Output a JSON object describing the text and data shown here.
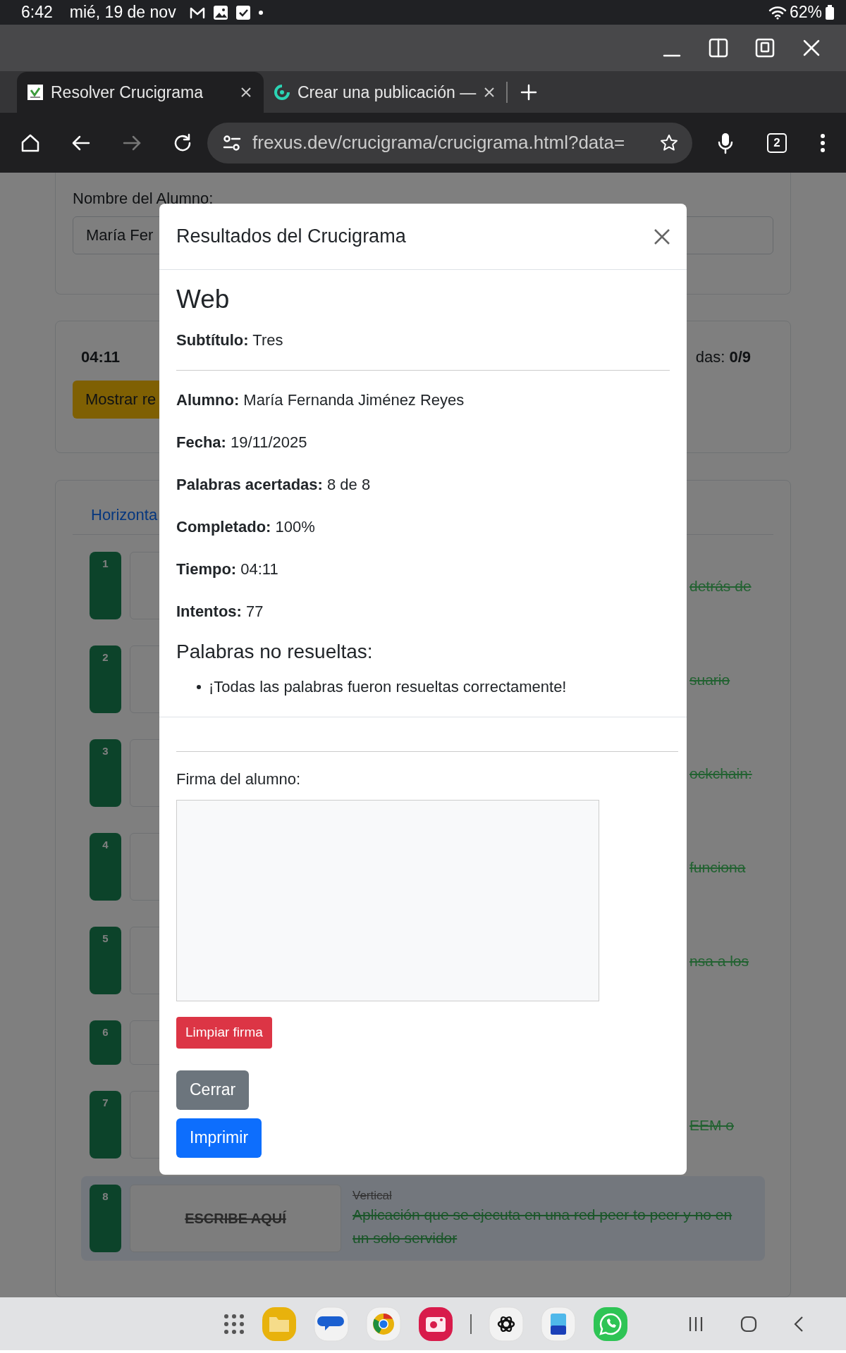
{
  "status_bar": {
    "time": "6:42",
    "date": "mié, 19 de nov",
    "battery": "62%"
  },
  "browser": {
    "tabs": [
      {
        "title": "Resolver Crucigrama",
        "selected": true
      },
      {
        "title": "Crear una publicación —",
        "selected": false
      }
    ],
    "url": "frexus.dev/crucigrama/crucigrama.html?data=",
    "tab_count": "2"
  },
  "page": {
    "student_label": "Nombre del Alumno:",
    "student_value": "María Fer",
    "timer": "04:11",
    "show_button": "Mostrar re",
    "score_tail": "das: **0/9**",
    "section_tab": "Horizonta",
    "rows": [
      {
        "kind": "partial",
        "number": "1",
        "clue": "detrás de",
        "solved": true,
        "selected": false
      },
      {
        "kind": "partial",
        "number": "2",
        "clue": "suario",
        "solved": true,
        "selected": false
      },
      {
        "kind": "partial",
        "number": "3",
        "clue": "ockchain:",
        "solved": true,
        "selected": false
      },
      {
        "kind": "partial",
        "number": "4",
        "clue": "funciona",
        "solved": true,
        "selected": false
      },
      {
        "kind": "partial",
        "number": "5",
        "clue": "nsa a los",
        "solved": true,
        "selected": false
      },
      {
        "kind": "partial",
        "number": "6",
        "selected": false
      },
      {
        "kind": "partial",
        "number": "7",
        "clue": "EEM o",
        "solved": true,
        "selected": false
      },
      {
        "kind": "full",
        "number": "8",
        "answer_placeholder": "ESCRIBE AQUÍ",
        "direction": "Vertical",
        "clue": "Aplicación que se ejecuta en una red peer to peer y no en un solo servidor",
        "solved": true,
        "selected": true
      }
    ]
  },
  "modal": {
    "title": "Resultados del Crucigrama",
    "heading": "Web",
    "subtitle": "**Subtítulo:** Tres",
    "facts": [
      "**Alumno:** María Fernanda Jiménez Reyes",
      "**Fecha:** 19/11/2025",
      "**Palabras acertadas:** 8 de 8",
      "**Completado:** 100%",
      "**Tiempo:** 04:11",
      "**Intentos:** 77"
    ],
    "unsolved_heading": "Palabras no resueltas:",
    "unsolved": [
      "¡Todas las palabras fueron resueltas correctamente!"
    ],
    "signature_label": "Firma del alumno:",
    "signature_button": {
      "label": "Limpiar firma",
      "kind": "danger"
    },
    "buttons": [
      {
        "label": "Cerrar",
        "kind": "secondary"
      },
      {
        "label": "Imprimir",
        "kind": "primary"
      }
    ]
  }
}
